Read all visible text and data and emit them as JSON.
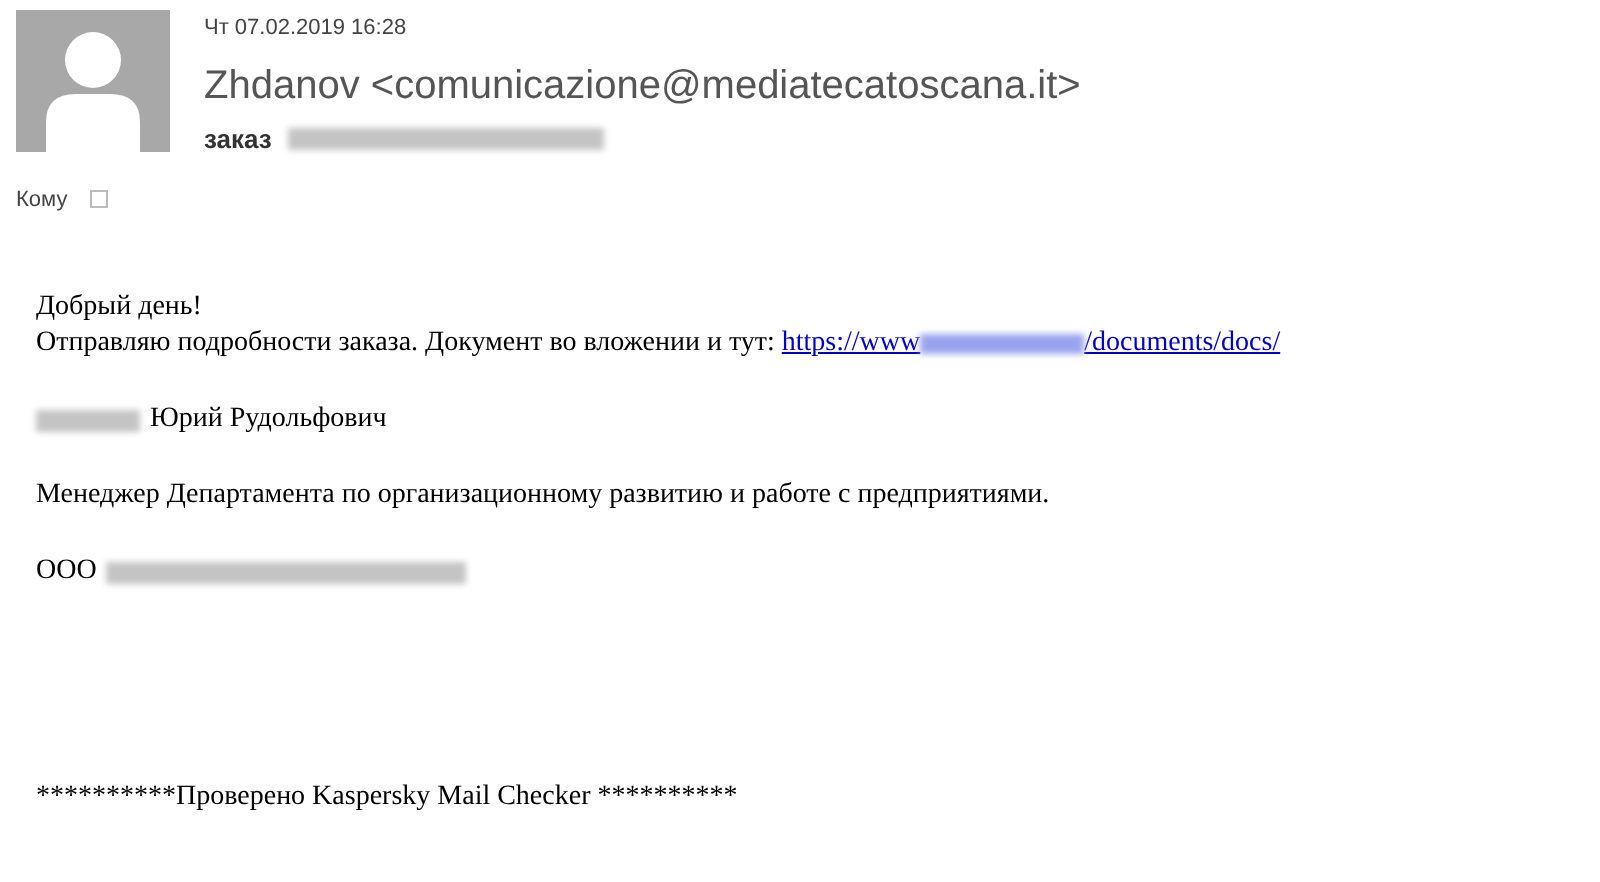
{
  "header": {
    "date": "Чт 07.02.2019 16:28",
    "sender": "Zhdanov <comunicazione@mediatecatoscana.it>",
    "subject": "заказ",
    "to_label": "Кому",
    "recipient_checked": false
  },
  "body": {
    "greeting": "Добрый день!",
    "intro": "Отправляю подробности заказа. Документ во вложении и тут:",
    "link_start": "https://www",
    "link_end": "/documents/docs/",
    "signature_name": "Юрий Рудольфович",
    "signature_role": "Менеджер Департамента по организационному развитию и работе с предприятиями.",
    "company_prefix": "ООО",
    "footer": "**********Проверено Kaspersky Mail Checker **********"
  }
}
